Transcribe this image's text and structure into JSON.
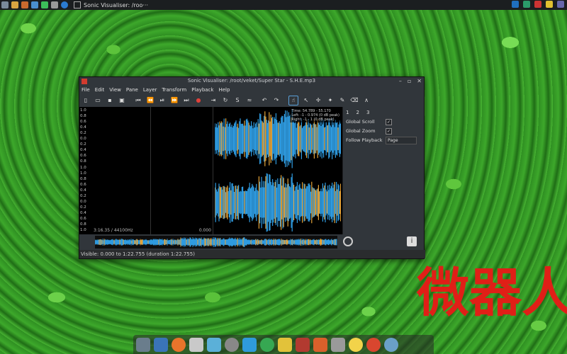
{
  "taskbar": {
    "task_label": "Sonic Visualiser: /roo···"
  },
  "window": {
    "title": "Sonic Visualiser: /root/veket/Super Star - S.H.E.mp3",
    "controls": [
      "–",
      "▫",
      "✕"
    ]
  },
  "menu": [
    "File",
    "Edit",
    "View",
    "Pane",
    "Layer",
    "Transform",
    "Playback",
    "Help"
  ],
  "ruler_labels": [
    "1.0",
    "0.8",
    "0.6",
    "0.4",
    "0.2",
    "0.0",
    "0.2",
    "0.4",
    "0.6",
    "0.8",
    "1.0",
    "1.0",
    "0.8",
    "0.6",
    "0.4",
    "0.2",
    "0.0",
    "0.2",
    "0.4",
    "0.6",
    "0.8",
    "1.0"
  ],
  "left_pane": {
    "timestamp": "3:16.35 / 44100Hz",
    "value": "0.000"
  },
  "right_pane": {
    "overlay_line1": "Time: 54.789 - 55.170",
    "overlay_line2": "Left: -1 - 0.974 (0 dB peak)",
    "overlay_line3": "Right: -1 - 1 (0 dB peak)"
  },
  "properties": {
    "tabs": [
      "1",
      "2",
      "3"
    ],
    "global_scroll_label": "Global Scroll",
    "global_scroll_checked": "✓",
    "global_zoom_label": "Global Zoom",
    "global_zoom_checked": "✓",
    "follow_playback_label": "Follow Playback",
    "follow_playback_value": "Page"
  },
  "status": {
    "text": "Visible: 0.000 to 1:22.755 (duration 1:22.755)"
  },
  "watermark": {
    "text": "微器人"
  },
  "colors": {
    "wave_blue": "#2f9be0",
    "wave_orange": "#e3a33a",
    "accent": "#5aa0d8"
  }
}
